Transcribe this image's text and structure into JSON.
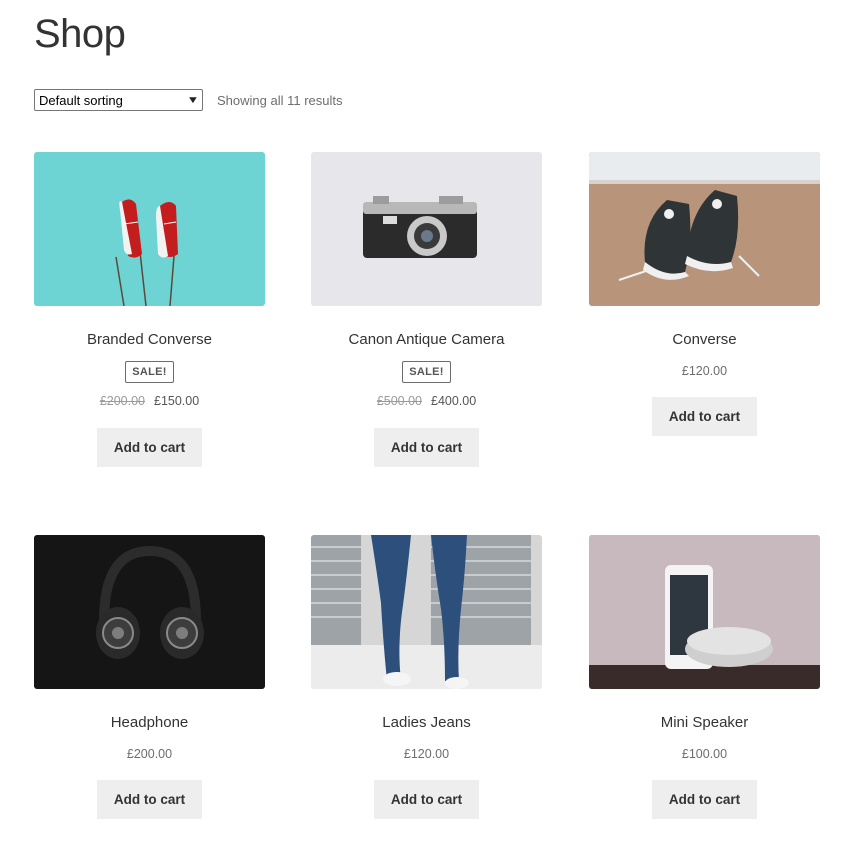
{
  "page": {
    "title": "Shop"
  },
  "toolbar": {
    "sorting_selected": "Default sorting",
    "result_count": "Showing all 11 results"
  },
  "products": [
    {
      "name": "Branded Converse",
      "sale": true,
      "badge": "SALE!",
      "regular_price": "£200.00",
      "price": "£150.00",
      "button": "Add to cart"
    },
    {
      "name": "Canon Antique Camera",
      "sale": true,
      "badge": "SALE!",
      "regular_price": "£500.00",
      "price": "£400.00",
      "button": "Add to cart"
    },
    {
      "name": "Converse",
      "sale": false,
      "price": "£120.00",
      "button": "Add to cart"
    },
    {
      "name": "Headphone",
      "sale": false,
      "price": "£200.00",
      "button": "Add to cart"
    },
    {
      "name": "Ladies Jeans",
      "sale": false,
      "price": "£120.00",
      "button": "Add to cart"
    },
    {
      "name": "Mini Speaker",
      "sale": false,
      "price": "£100.00",
      "button": "Add to cart"
    }
  ]
}
